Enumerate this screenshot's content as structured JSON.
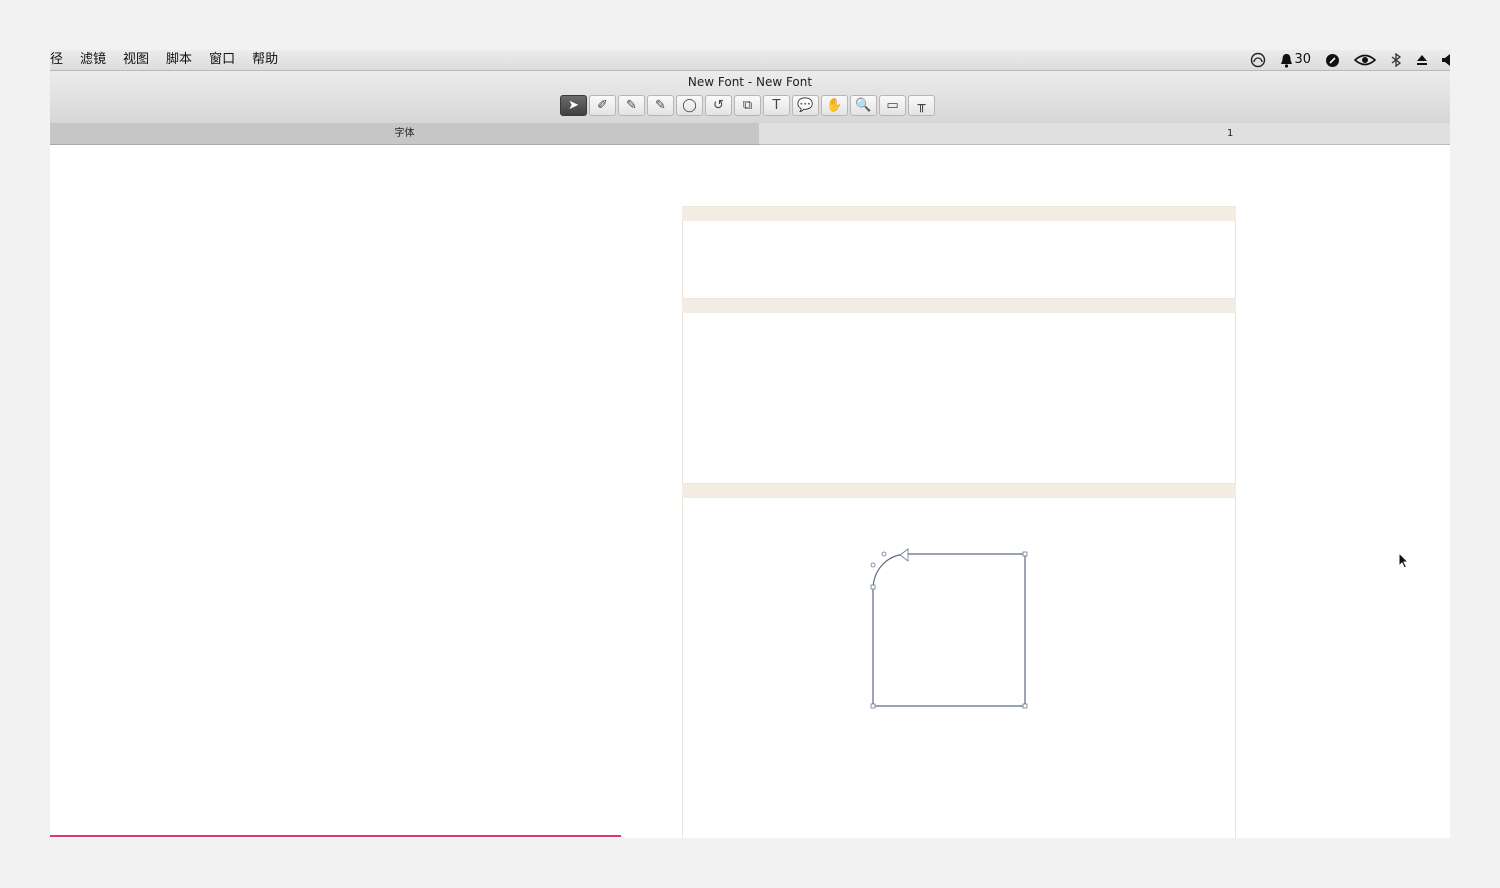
{
  "menubar": {
    "items": [
      "径",
      "滤镜",
      "视图",
      "脚本",
      "窗口",
      "帮助"
    ],
    "status": {
      "notification_count": "30",
      "icons": [
        "headphones-icon",
        "qq-bell-icon",
        "evernote-icon",
        "nvidia-icon",
        "bluetooth-icon",
        "eject-icon",
        "volume-icon"
      ]
    }
  },
  "window": {
    "title": "New Font - New Font"
  },
  "toolbar": {
    "tools": [
      "pointer-tool-icon",
      "pen-nib-tool-icon",
      "pencil-tool-icon",
      "brush-tool-icon",
      "ellipse-tool-icon",
      "rotate-tool-icon",
      "scale-tool-icon",
      "text-tool-icon",
      "speech-bubble-tool-icon",
      "hand-tool-icon",
      "zoom-tool-icon",
      "ruler-tool-icon",
      "measure-tool-icon"
    ],
    "glyphs": [
      "➤",
      "✐",
      "✎",
      "✎",
      "◯",
      "↺",
      "⧉",
      "T",
      "💬",
      "✋",
      "🔍",
      "▭",
      "╥"
    ],
    "active_index": 0
  },
  "columns": {
    "left_label": "字体",
    "right_label": "1"
  },
  "colors": {
    "band": "#f3ece3",
    "progress": "#e8326d",
    "path": "#5a6a80"
  }
}
